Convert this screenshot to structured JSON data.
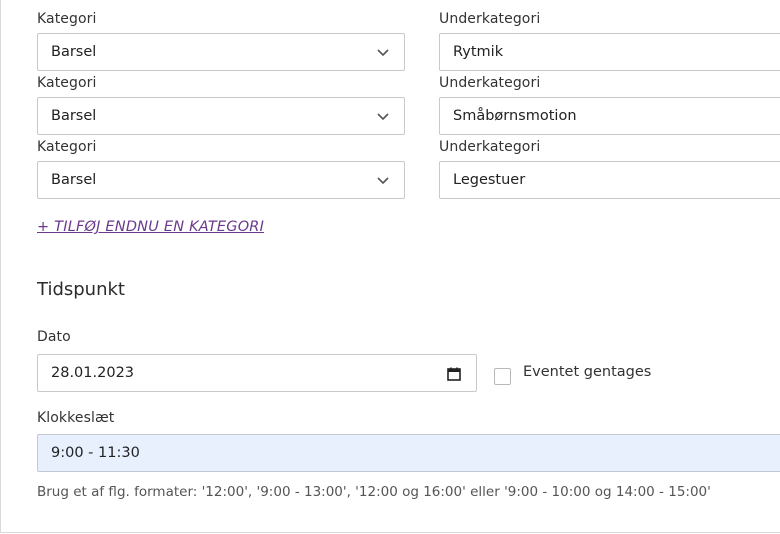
{
  "categories": [
    {
      "category_label": "Kategori",
      "category_value": "Barsel",
      "sub_label": "Underkategori",
      "sub_value": "Rytmik"
    },
    {
      "category_label": "Kategori",
      "category_value": "Barsel",
      "sub_label": "Underkategori",
      "sub_value": "Småbørnsmotion"
    },
    {
      "category_label": "Kategori",
      "category_value": "Barsel",
      "sub_label": "Underkategori",
      "sub_value": "Legestuer"
    }
  ],
  "add_category_link": "+ TILFØJ ENDNU EN KATEGORI",
  "time_section": {
    "heading": "Tidspunkt",
    "date_label": "Dato",
    "date_value": "28.01.2023",
    "repeat_label": "Eventet gentages",
    "time_label": "Klokkeslæt",
    "time_value": "9:00 - 11:30",
    "help_text": "Brug et af flg. formater: '12:00', '9:00 - 13:00', '12:00 og 16:00' eller '9:00 - 10:00 og 14:00 - 15:00'"
  },
  "icons": {
    "dropdown": "chevron-down-icon",
    "date": "calendar-icon"
  },
  "colors": {
    "link": "#6b3a8c",
    "time_field_bg": "#e8f0fe"
  }
}
